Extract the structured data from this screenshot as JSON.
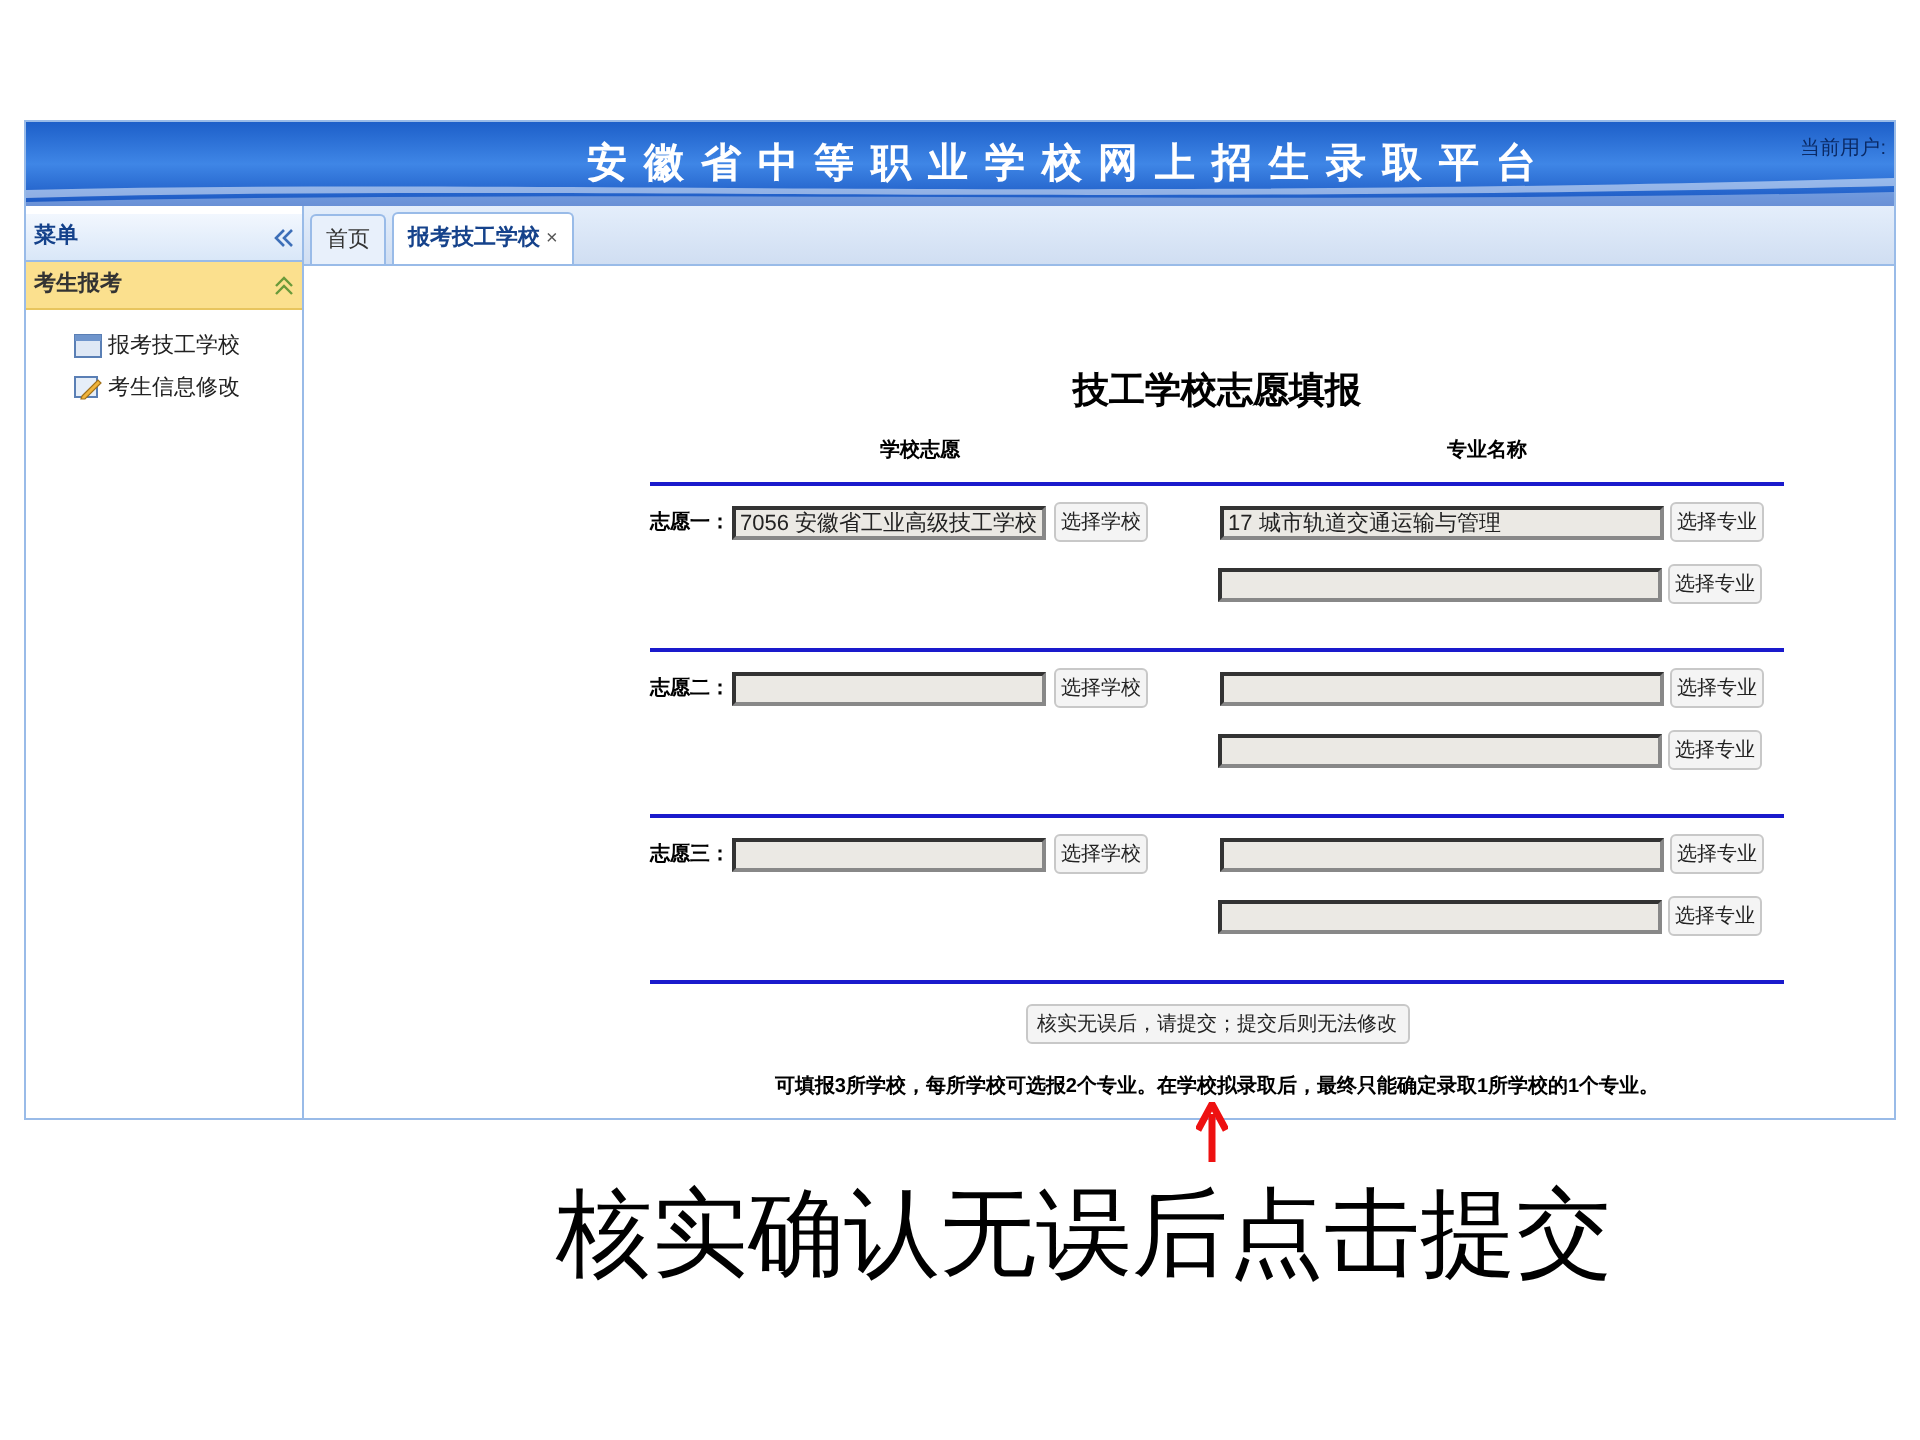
{
  "header": {
    "title": "安徽省中等职业学校网上招生录取平台",
    "user_label": "当前用户:"
  },
  "sidebar": {
    "title": "菜单",
    "section": {
      "title": "考生报考",
      "expanded": true,
      "items": [
        {
          "label": "报考技工学校",
          "kind": "window"
        },
        {
          "label": "考生信息修改",
          "kind": "edit"
        }
      ]
    }
  },
  "tabs": [
    {
      "label": "首页",
      "selected": false
    },
    {
      "label": "报考技工学校",
      "selected": true,
      "close": "×"
    }
  ],
  "form": {
    "title": "技工学校志愿填报",
    "columns": [
      "学校志愿",
      "专业名称"
    ],
    "choices": [
      {
        "label": "志愿一：",
        "school": "7056 安徽省工业高级技工学校",
        "school_button": "选择学校",
        "majors": [
          {
            "value": "17 城市轨道交通运输与管理",
            "button": "选择专业"
          },
          {
            "button": "选择专业"
          }
        ]
      },
      {
        "label": "志愿二：",
        "school_button": "选择学校",
        "majors": [
          {
            "button": "选择专业"
          },
          {
            "button": "选择专业"
          }
        ]
      },
      {
        "label": "志愿三：",
        "school_button": "选择学校",
        "majors": [
          {
            "button": "选择专业"
          },
          {
            "button": "选择专业"
          }
        ]
      }
    ],
    "submit_button": "核实无误后，请提交；提交后则无法修改",
    "notice": "可填报3所学校，每所学校可选报2个专业。在学校拟录取后，最终只能确定录取1所学校的1个专业。"
  },
  "annotation": {
    "caption": "核实确认无误后点击提交"
  }
}
